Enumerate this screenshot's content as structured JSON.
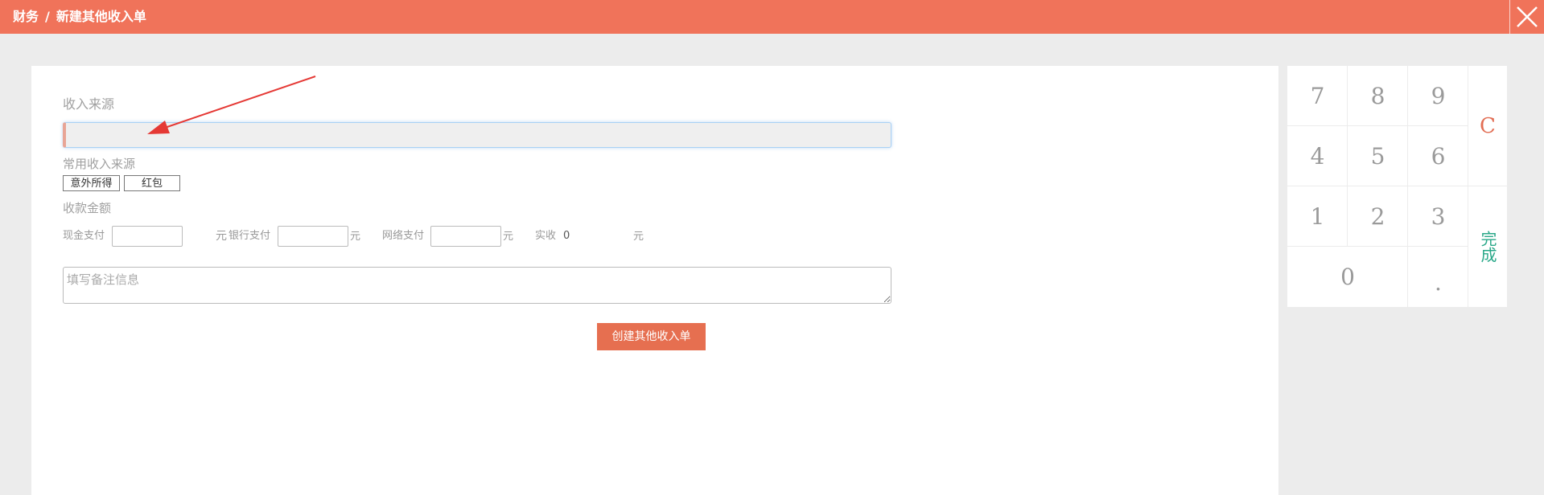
{
  "header": {
    "section": "财务",
    "separator": "/",
    "page": "新建其他收入单"
  },
  "form": {
    "source_label": "收入来源",
    "source_value": "",
    "common_label": "常用收入来源",
    "common_sources": [
      "意外所得",
      "红包"
    ],
    "amount_label": "收款金额",
    "cash_label": "现金支付",
    "cash_value": "",
    "cash_unit": "元",
    "bank_label": "银行支付",
    "bank_value": "",
    "bank_unit": "元",
    "online_label": "网络支付",
    "online_value": "",
    "online_unit": "元",
    "actual_label": "实收",
    "actual_value": "0",
    "actual_unit": "元",
    "memo_placeholder": "填写备注信息",
    "submit_label": "创建其他收入单"
  },
  "keypad": {
    "keys": [
      "7",
      "8",
      "9",
      "4",
      "5",
      "6",
      "1",
      "2",
      "3",
      "0",
      "."
    ],
    "clear": "C",
    "done": "完成"
  },
  "colors": {
    "header_bg": "#f0735a",
    "button_bg": "#e66f50",
    "clear_key": "#e26e54",
    "done_key": "#2aa889"
  }
}
